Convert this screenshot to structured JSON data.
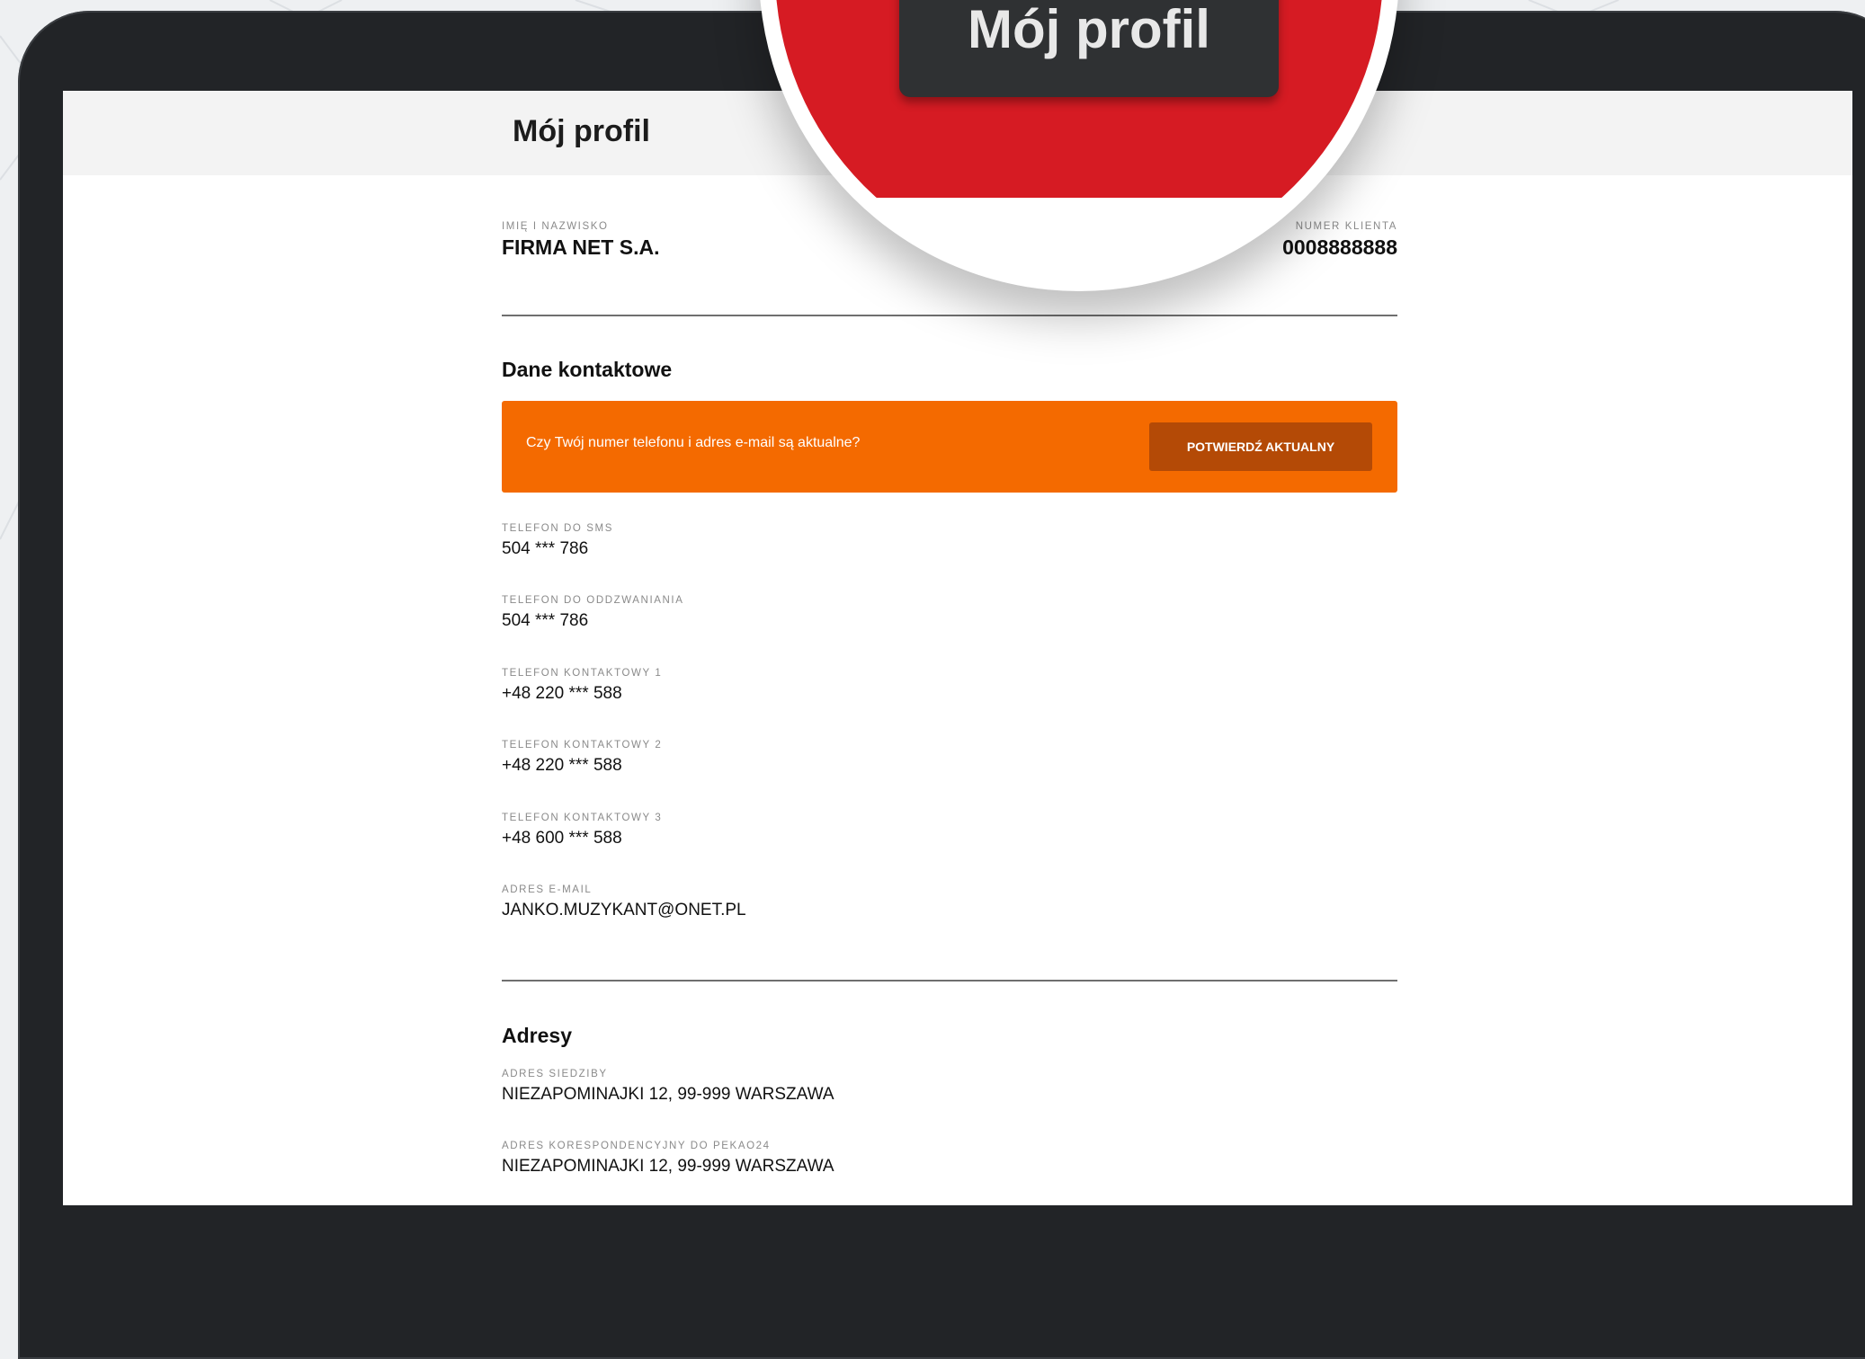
{
  "header": {
    "title": "Mój profil"
  },
  "magnifier": {
    "label": "Mój profil"
  },
  "profile": {
    "name_label": "IMIĘ I NAZWISKO",
    "name_value": "FIRMA NET S.A.",
    "client_label": "NUMER KLIENTA",
    "client_value": "0008888888"
  },
  "contact": {
    "section_title": "Dane kontaktowe",
    "banner_text": "Czy Twój numer telefonu i adres e-mail są aktualne?",
    "banner_button": "POTWIERDŹ AKTUALNY",
    "fields": [
      {
        "label": "TELEFON DO SMS",
        "value": "504 *** 786"
      },
      {
        "label": "TELEFON DO ODDZWANIANIA",
        "value": "504 *** 786"
      },
      {
        "label": "TELEFON KONTAKTOWY 1",
        "value": "+48 220 *** 588"
      },
      {
        "label": "TELEFON KONTAKTOWY 2",
        "value": "+48 220 *** 588"
      },
      {
        "label": "TELEFON KONTAKTOWY 3",
        "value": "+48 600 *** 588"
      },
      {
        "label": "ADRES E-MAIL",
        "value": "JANKO.MUZYKANT@ONET.PL"
      }
    ]
  },
  "addresses": {
    "section_title": "Adresy",
    "fields": [
      {
        "label": "ADRES SIEDZIBY",
        "value": "NIEZAPOMINAJKI 12, 99-999 WARSZAWA"
      },
      {
        "label": "ADRES KORESPONDENCYJNY DO PEKAO24",
        "value": "NIEZAPOMINAJKI 12, 99-999 WARSZAWA"
      }
    ]
  },
  "colors": {
    "banner": "#f46a00",
    "banner_button": "#b44a06",
    "magnifier_red": "#d61b23",
    "laptop_bezel": "#222427"
  }
}
